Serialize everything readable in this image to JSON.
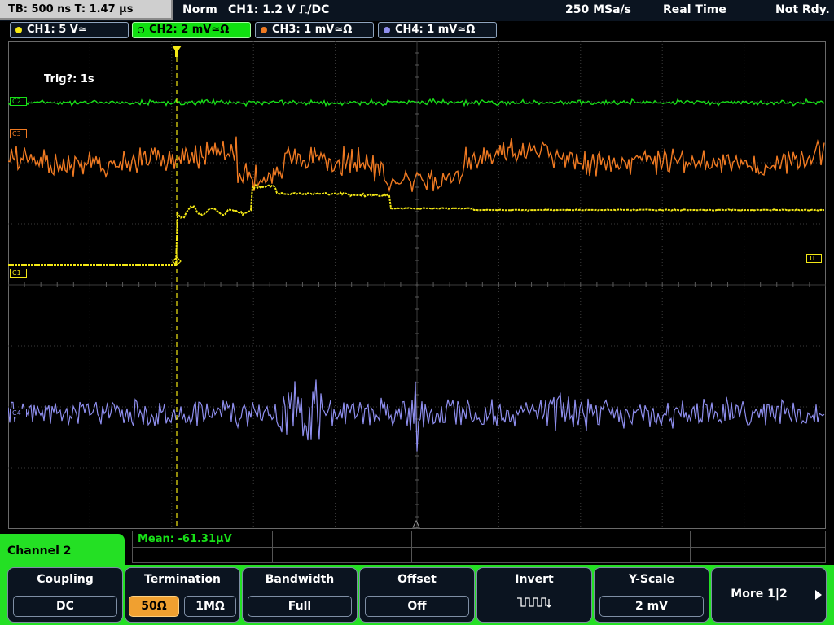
{
  "status": {
    "timebase": "TB: 500 ns   T: 1.47 µs",
    "mode": "Norm",
    "trigger": "CH1: 1.2 V ⎍/DC",
    "sample_rate": "250 MSa/s",
    "acquisition": "Real Time",
    "state": "Not Rdy."
  },
  "channels": [
    {
      "label": "CH1: 5 V≃",
      "color": "#f4e815"
    },
    {
      "label": "CH2: 2 mV≃Ω",
      "color": "#18e018",
      "active": true
    },
    {
      "label": "CH3: 1 mV≃Ω",
      "color": "#f07a22"
    },
    {
      "label": "CH4: 1 mV≃Ω",
      "color": "#8f8fef"
    }
  ],
  "grid": {
    "trigger_text": "Trig?: 1s",
    "label_c1": "C1",
    "label_c2": "C2",
    "label_c3": "C3",
    "label_c4": "C4",
    "label_tl": "TL"
  },
  "measurement": {
    "mean": "Mean: -61.31µV"
  },
  "menu": {
    "title": "Channel 2",
    "coupling": {
      "title": "Coupling",
      "value": "DC"
    },
    "termination": {
      "title": "Termination",
      "opt1": "50Ω",
      "opt2": "1MΩ",
      "selected": "50Ω"
    },
    "bandwidth": {
      "title": "Bandwidth",
      "value": "Full"
    },
    "offset": {
      "title": "Offset",
      "value": "Off"
    },
    "invert": {
      "title": "Invert",
      "icon": "square-wave-invert-icon"
    },
    "yscale": {
      "title": "Y-Scale",
      "value": "2 mV"
    },
    "more": {
      "label": "More 1|2"
    }
  }
}
